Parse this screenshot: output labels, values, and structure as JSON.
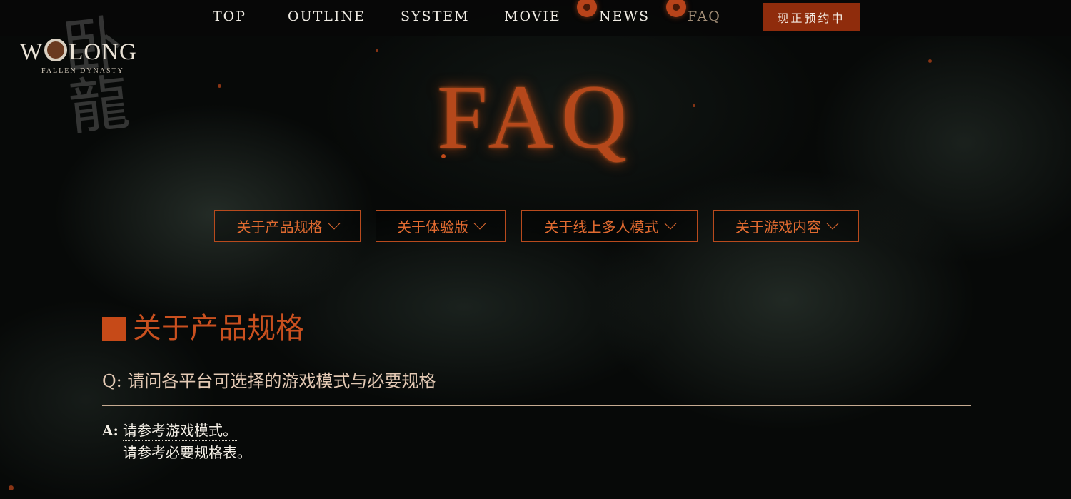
{
  "nav": {
    "items": [
      {
        "label": "TOP"
      },
      {
        "label": "OUTLINE"
      },
      {
        "label": "SYSTEM"
      },
      {
        "label": "MOVIE"
      },
      {
        "label": "NEWS"
      },
      {
        "label": "FAQ"
      }
    ],
    "cta_label": "现正预约中"
  },
  "logo": {
    "calligraphy": "卧龍",
    "main_left": "W",
    "main_right": "LONG",
    "subtitle": "FALLEN DYNASTY"
  },
  "page_title": "FAQ",
  "tabs": [
    {
      "label": "关于产品规格"
    },
    {
      "label": "关于体验版"
    },
    {
      "label": "关于线上多人模式"
    },
    {
      "label": "关于游戏内容"
    }
  ],
  "section": {
    "title": "关于产品规格",
    "question_label": "Q:",
    "question_text": "请问各平台可选择的游戏模式与必要规格",
    "answer_label": "A:",
    "answer_links": [
      {
        "text": "请参考游戏模式。"
      },
      {
        "text": "请参考必要规格表。"
      }
    ]
  },
  "colors": {
    "accent": "#c64a18",
    "title_glow": "#b5481b",
    "cta_bg": "#8f2c0c",
    "nav_active": "#a48f78"
  }
}
